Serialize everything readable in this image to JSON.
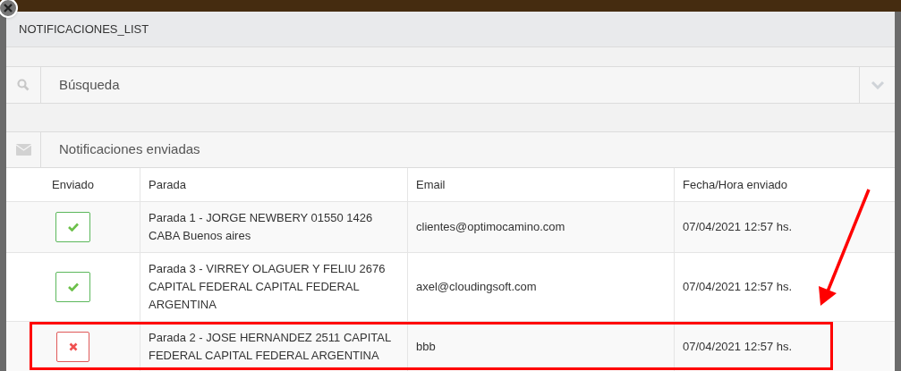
{
  "window": {
    "title": "NOTIFICACIONES_LIST"
  },
  "search_panel": {
    "title": "Búsqueda",
    "expanded": false
  },
  "results_panel": {
    "title": "Notificaciones enviadas"
  },
  "table": {
    "columns": [
      "Enviado",
      "Parada",
      "Email",
      "Fecha/Hora enviado"
    ],
    "rows": [
      {
        "sent": true,
        "highlighted": false,
        "parada": "Parada 1 - JORGE NEWBERY 01550 1426 CABA Buenos aires",
        "email": "clientes@optimocamino.com",
        "datetime": "07/04/2021 12:57 hs."
      },
      {
        "sent": true,
        "highlighted": false,
        "parada": "Parada 3 - VIRREY OLAGUER Y FELIU 2676 CAPITAL FEDERAL CAPITAL FEDERAL ARGENTINA",
        "email": "axel@cloudingsoft.com",
        "datetime": "07/04/2021 12:57 hs."
      },
      {
        "sent": false,
        "highlighted": true,
        "parada": "Parada 2 - JOSE HERNANDEZ 2511 CAPITAL FEDERAL CAPITAL FEDERAL ARGENTINA",
        "email": "bbb",
        "datetime": "07/04/2021 12:57 hs."
      }
    ]
  }
}
